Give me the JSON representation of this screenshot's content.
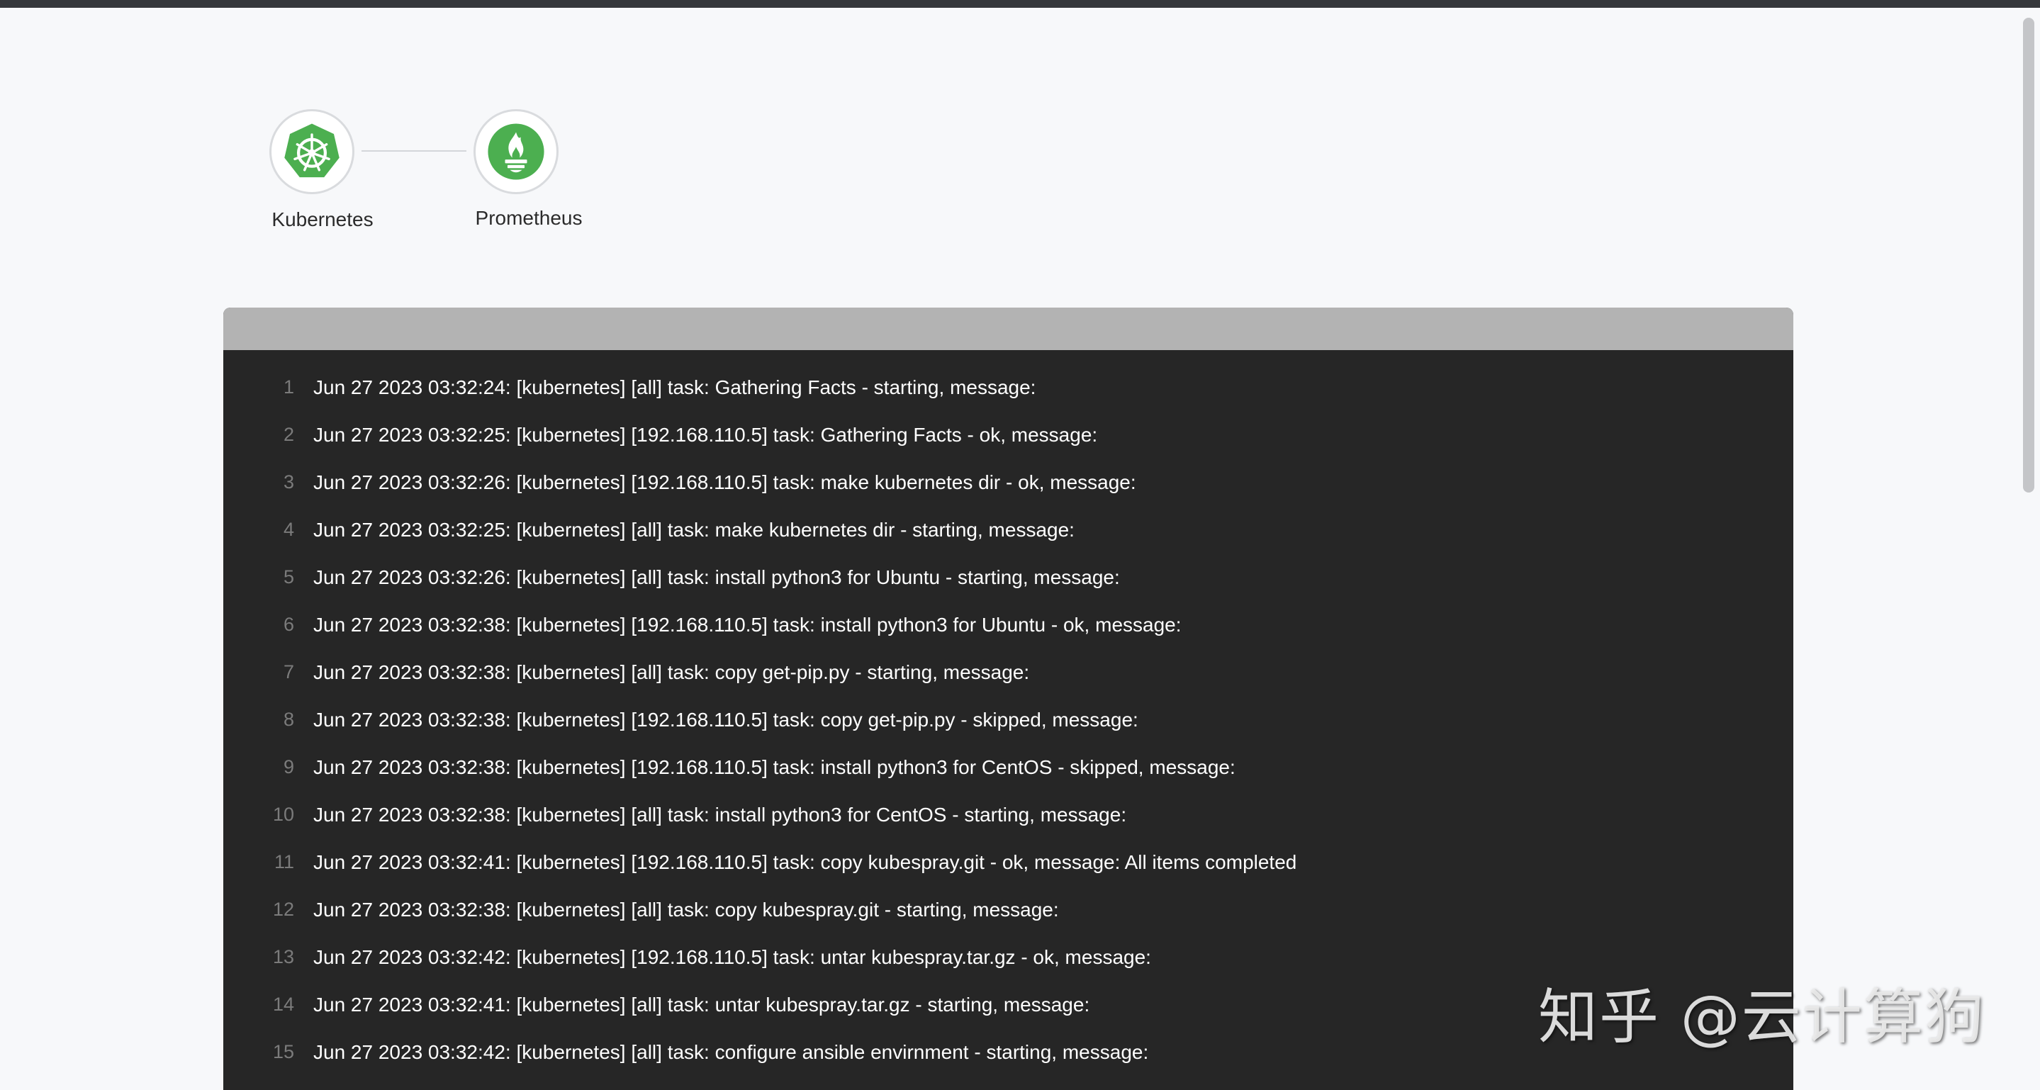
{
  "nodes": [
    {
      "label": "Kubernetes",
      "icon": "kubernetes-helm-icon"
    },
    {
      "label": "Prometheus",
      "icon": "prometheus-flame-icon"
    }
  ],
  "colors": {
    "node_icon_green": "#4caf50",
    "log_background": "#262626",
    "log_header": "#b3b3b3",
    "page_background": "#f7f8fa"
  },
  "log": {
    "lines": [
      {
        "num": "1",
        "text": "Jun 27 2023 03:32:24: [kubernetes] [all] task: Gathering Facts - starting, message:"
      },
      {
        "num": "2",
        "text": "Jun 27 2023 03:32:25: [kubernetes] [192.168.110.5] task: Gathering Facts - ok, message:"
      },
      {
        "num": "3",
        "text": "Jun 27 2023 03:32:26: [kubernetes] [192.168.110.5] task: make kubernetes dir - ok, message:"
      },
      {
        "num": "4",
        "text": "Jun 27 2023 03:32:25: [kubernetes] [all] task: make kubernetes dir - starting, message:"
      },
      {
        "num": "5",
        "text": "Jun 27 2023 03:32:26: [kubernetes] [all] task: install python3 for Ubuntu - starting, message:"
      },
      {
        "num": "6",
        "text": "Jun 27 2023 03:32:38: [kubernetes] [192.168.110.5] task: install python3 for Ubuntu - ok, message:"
      },
      {
        "num": "7",
        "text": "Jun 27 2023 03:32:38: [kubernetes] [all] task: copy get-pip.py - starting, message:"
      },
      {
        "num": "8",
        "text": "Jun 27 2023 03:32:38: [kubernetes] [192.168.110.5] task: copy get-pip.py - skipped, message:"
      },
      {
        "num": "9",
        "text": "Jun 27 2023 03:32:38: [kubernetes] [192.168.110.5] task: install python3 for CentOS - skipped, message:"
      },
      {
        "num": "10",
        "text": "Jun 27 2023 03:32:38: [kubernetes] [all] task: install python3 for CentOS - starting, message:"
      },
      {
        "num": "11",
        "text": "Jun 27 2023 03:32:41: [kubernetes] [192.168.110.5] task: copy kubespray.git - ok, message: All items completed"
      },
      {
        "num": "12",
        "text": "Jun 27 2023 03:32:38: [kubernetes] [all] task: copy kubespray.git - starting, message:"
      },
      {
        "num": "13",
        "text": "Jun 27 2023 03:32:42: [kubernetes] [192.168.110.5] task: untar kubespray.tar.gz - ok, message:"
      },
      {
        "num": "14",
        "text": "Jun 27 2023 03:32:41: [kubernetes] [all] task: untar kubespray.tar.gz - starting, message:"
      },
      {
        "num": "15",
        "text": "Jun 27 2023 03:32:42: [kubernetes] [all] task: configure ansible envirnment - starting, message:"
      }
    ]
  },
  "watermark": "知乎 @云计算狗"
}
